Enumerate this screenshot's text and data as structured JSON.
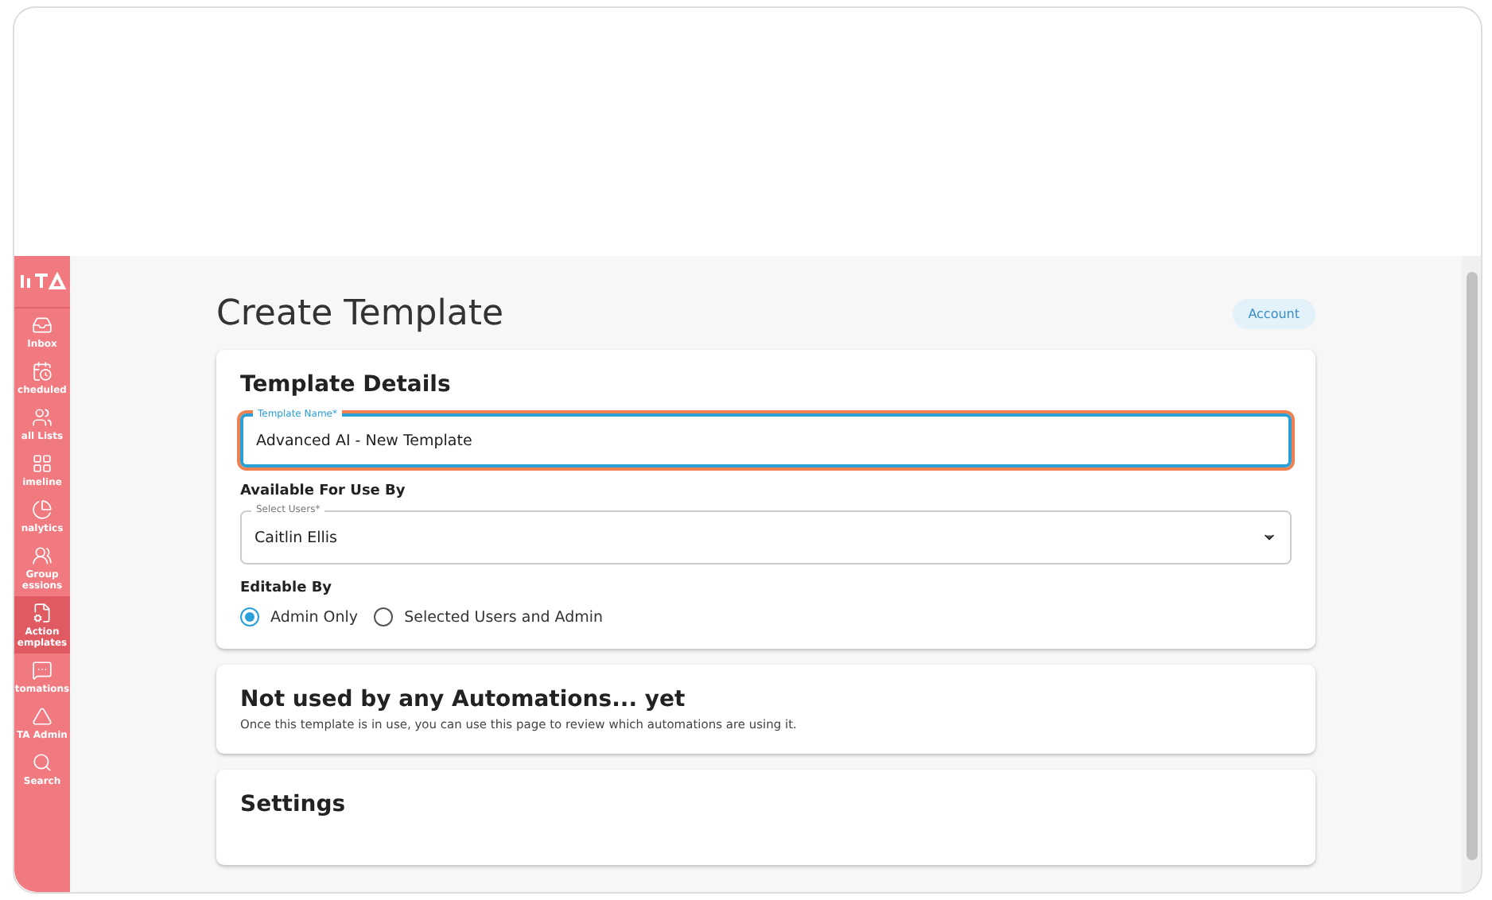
{
  "sidebar": {
    "items": [
      {
        "label": "Inbox",
        "selected": false
      },
      {
        "label": "cheduled",
        "selected": false
      },
      {
        "label": "all Lists",
        "selected": false
      },
      {
        "label": "imeline",
        "selected": false
      },
      {
        "label": "nalytics",
        "selected": false
      },
      {
        "label": "Group essions",
        "selected": false
      },
      {
        "label": "Action emplates",
        "selected": true
      },
      {
        "label": "tomations",
        "selected": false
      },
      {
        "label": "TA Admin",
        "selected": false
      },
      {
        "label": "Search",
        "selected": false
      }
    ]
  },
  "page": {
    "title": "Create Template",
    "account": "Account"
  },
  "details": {
    "heading": "Template Details",
    "name_field": {
      "label": "Template Name*",
      "value": "Advanced AI - New Template"
    },
    "available_heading": "Available For Use By",
    "users_field": {
      "label": "Select Users*",
      "value": "Caitlin Ellis"
    },
    "editable_heading": "Editable By",
    "options": [
      {
        "label": "Admin Only",
        "selected": true
      },
      {
        "label": "Selected Users and Admin",
        "selected": false
      }
    ]
  },
  "automations": {
    "heading": "Not used by any Automations... yet",
    "text": "Once this template is in use, you can use this page to review which automations are using it."
  },
  "settings": {
    "heading": "Settings"
  }
}
